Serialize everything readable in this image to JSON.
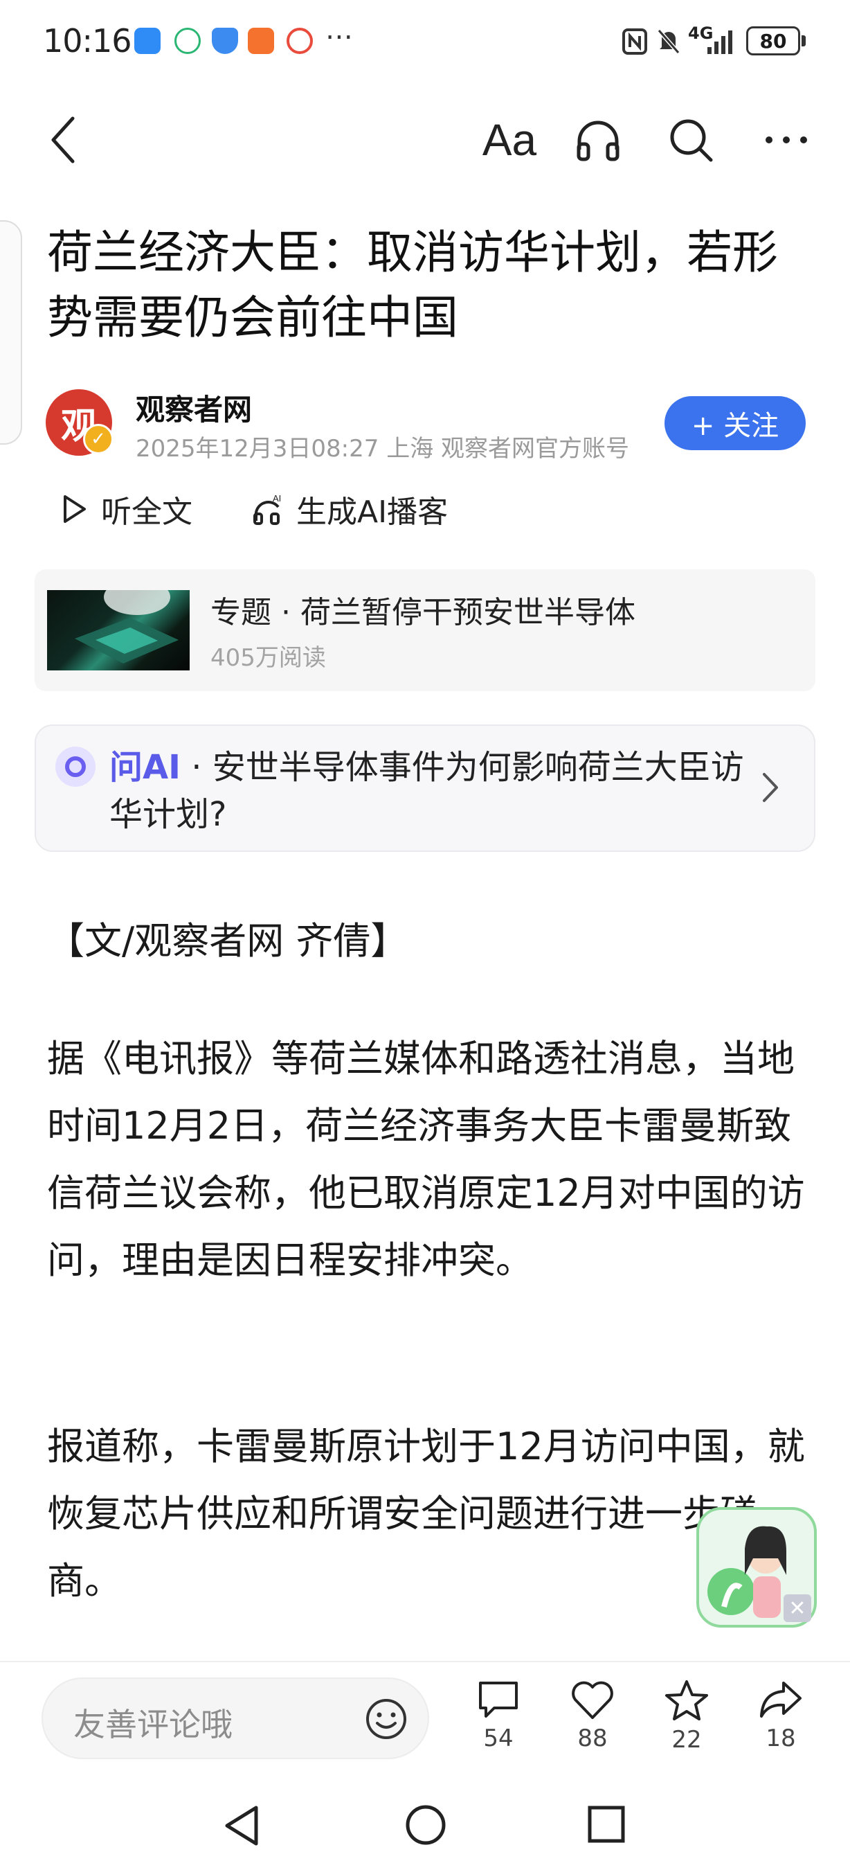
{
  "status_bar": {
    "time": "10:16",
    "network": "4G",
    "battery": "80",
    "more_icon": "⋯"
  },
  "toolbar": {
    "back_icon": "back-arrow-icon",
    "font_size_label": "Aa",
    "listen_icon": "headphones-icon",
    "search_icon": "search-icon",
    "more_icon": "more-icon"
  },
  "article": {
    "headline": "荷兰经济大臣：取消访华计划，若形势需要仍会前往中国",
    "author": {
      "avatar_text": "观",
      "name": "观察者网",
      "meta": "2025年12月3日08:27 上海 观察者网官方账号",
      "follow_label": "+ 关注"
    },
    "listen_full": "听全文",
    "ai_podcast": "生成AI播客",
    "topic": {
      "title": "专题 · 荷兰暂停干预安世半导体",
      "reads": "405万阅读"
    },
    "ask_ai": {
      "brand": "问AI",
      "question": " · 安世半导体事件为何影响荷兰大臣访华计划?"
    },
    "paragraphs": [
      "【文/观察者网 齐倩】",
      "据《电讯报》等荷兰媒体和路透社消息，当地时间12月2日，荷兰经济事务大臣卡雷曼斯致信荷兰议会称，他已取消原定12月对中国的访问，理由是因日程安排冲突。",
      "报道称，卡雷曼斯原计划于12月访问中国，就恢复芯片供应和所谓安全问题进行进一步磋商。"
    ]
  },
  "bottom_bar": {
    "comment_placeholder": "友善评论哦",
    "comments": "54",
    "likes": "88",
    "favorites": "22",
    "shares": "18"
  },
  "colors": {
    "accent_blue": "#3b73ee",
    "ai_purple": "#5a5be8",
    "avatar_red": "#d63a2e"
  }
}
